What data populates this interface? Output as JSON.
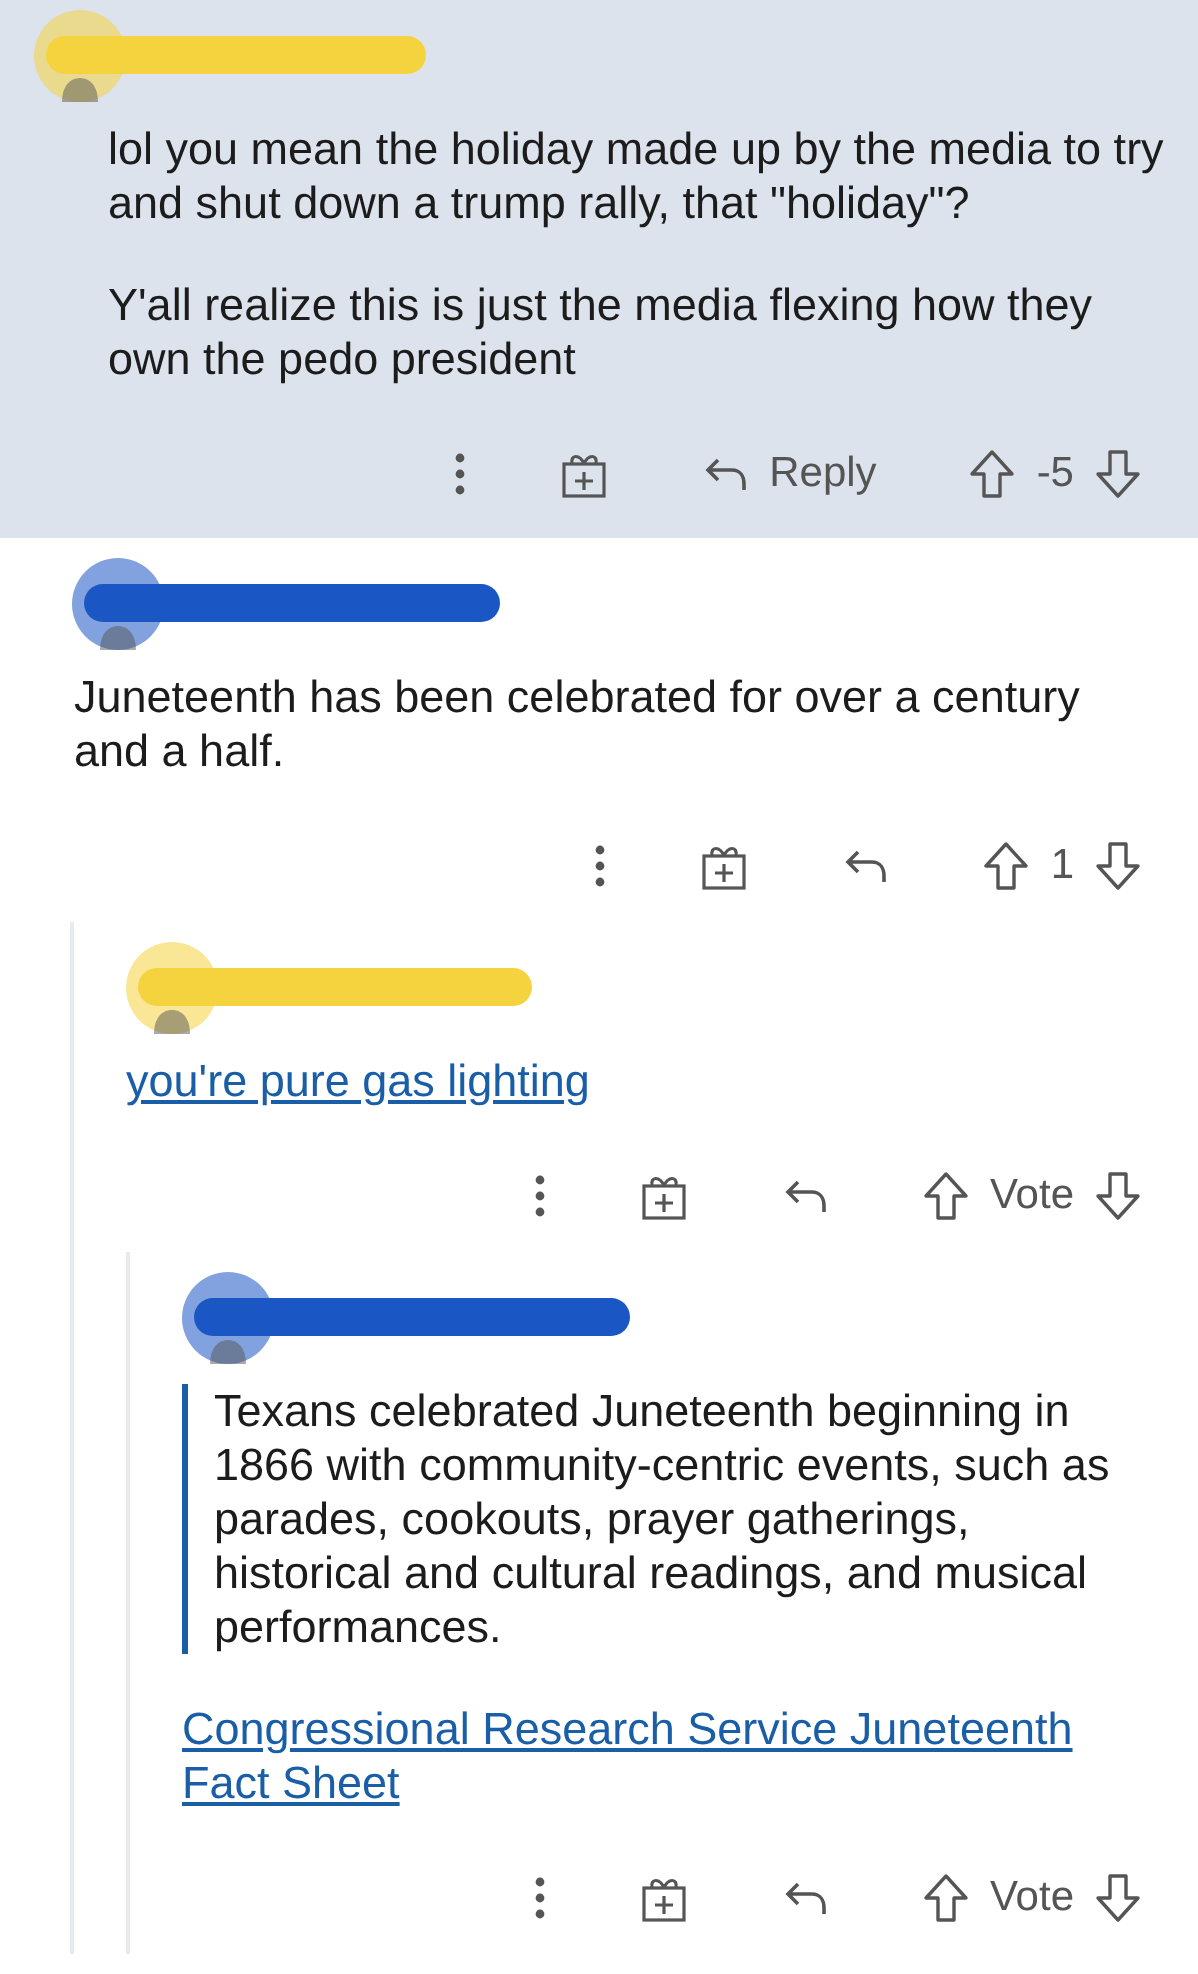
{
  "comments": [
    {
      "highlighted": true,
      "color": "#f5d33f",
      "body": [
        {
          "kind": "text",
          "text": "lol you mean the holiday made up by the media to try and shut down a trump rally, that \"holiday\"?"
        },
        {
          "kind": "text",
          "text": "Y'all realize this is just the media flexing how they own the pedo president"
        }
      ],
      "actions": {
        "reply_label": "Reply",
        "score": "-5"
      },
      "children": [
        {
          "highlighted": false,
          "color": "#1a56c4",
          "body": [
            {
              "kind": "text",
              "text": "Juneteenth has been celebrated for over a century and a half."
            }
          ],
          "actions": {
            "score": "1"
          },
          "children": [
            {
              "highlighted": false,
              "color": "#f5d33f",
              "body": [
                {
                  "kind": "link",
                  "text": "you're pure gas lighting"
                }
              ],
              "actions": {
                "score": "Vote"
              },
              "children": [
                {
                  "highlighted": false,
                  "color": "#1a56c4",
                  "body": [
                    {
                      "kind": "quote",
                      "text": "Texans celebrated Juneteenth beginning in 1866 with community-centric events, such as parades, cookouts, prayer gatherings, historical and cultural readings, and musical performances."
                    },
                    {
                      "kind": "link",
                      "text": "Congressional Research Service Juneteenth Fact Sheet"
                    }
                  ],
                  "actions": {
                    "score": "Vote"
                  }
                }
              ]
            }
          ]
        }
      ]
    }
  ]
}
